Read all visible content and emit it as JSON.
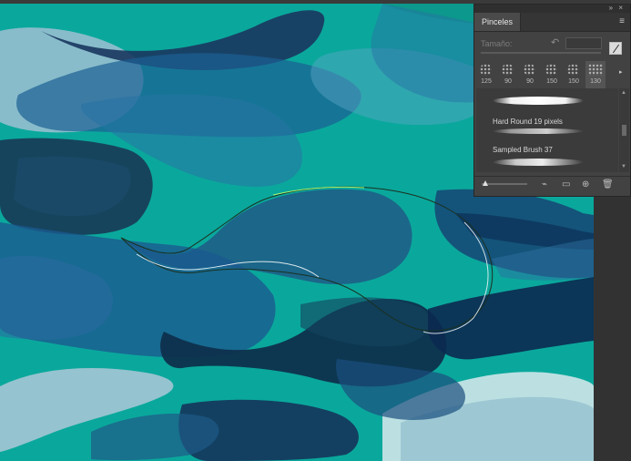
{
  "panel": {
    "tab_label": "Pinceles",
    "size_label": "Tamaño:",
    "presets": [
      "125",
      "90",
      "90",
      "150",
      "150",
      "130"
    ],
    "brushes": [
      {
        "label": "Hard Round 19 pixels"
      },
      {
        "label": "Sampled Brush 37"
      }
    ],
    "header_icons": [
      "collapse-icon",
      "close-icon"
    ],
    "footer_icons": [
      "toggle-brush-preview-icon",
      "new-group-icon",
      "new-brush-icon",
      "delete-icon"
    ]
  },
  "colors": {
    "canvas_bg": "#0aa89c",
    "panel_bg": "#424242",
    "dark_wave": "#0b2d4a",
    "deep_blue": "#12406f",
    "path_highlight": "#ffffff",
    "path_line": "#1a3020"
  }
}
